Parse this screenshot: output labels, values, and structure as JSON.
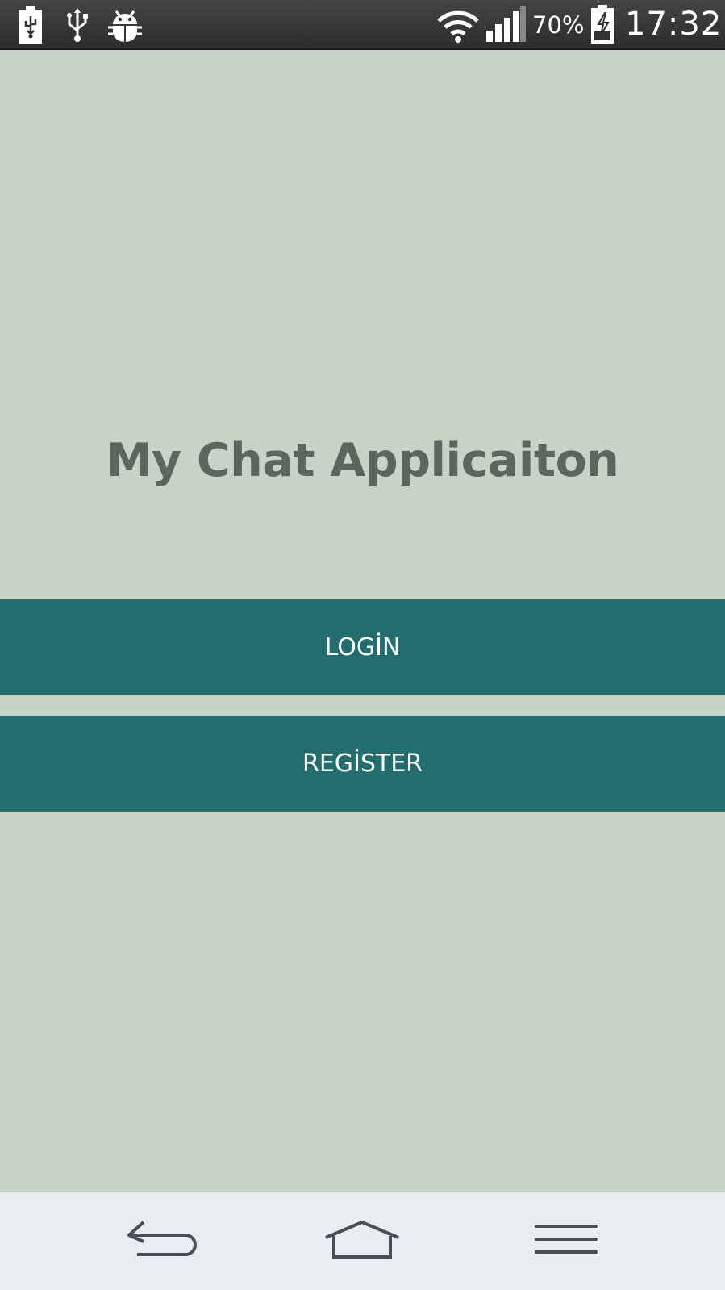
{
  "status_bar": {
    "left_icons": [
      "battery-usb-icon",
      "usb-icon",
      "android-debug-icon"
    ],
    "right_icons": [
      "wifi-icon",
      "signal-icon",
      "battery-charging-icon"
    ],
    "battery_percent": "70%",
    "time": "17:32",
    "colors": {
      "background": "#333333",
      "icon": "#ffffff"
    }
  },
  "app": {
    "title": "My Chat Applicaiton",
    "login_label": "LOGİN",
    "register_label": "REGİSTER",
    "colors": {
      "background": "#c6d4c8",
      "title_text": "#5d655f",
      "button_background": "#226e6e",
      "button_text": "#ffffff"
    }
  },
  "nav_bar": {
    "buttons": [
      "back-icon",
      "home-icon",
      "menu-icon"
    ],
    "colors": {
      "background": "#e8edf1",
      "icon": "#4a4e55"
    }
  }
}
